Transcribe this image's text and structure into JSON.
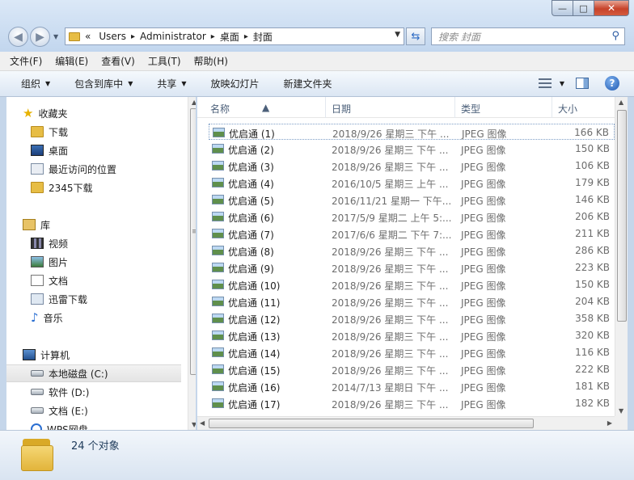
{
  "address": {
    "chevron": "«",
    "crumbs": [
      "Users",
      "Administrator",
      "桌面",
      "封面"
    ],
    "separator": "▸"
  },
  "search": {
    "placeholder": "搜索 封面"
  },
  "window_controls": {
    "minimize": "—",
    "maximize": "□",
    "close": "✕"
  },
  "menu": [
    "文件(F)",
    "编辑(E)",
    "查看(V)",
    "工具(T)",
    "帮助(H)"
  ],
  "toolbar": {
    "organize": "组织",
    "include_library": "包含到库中",
    "share": "共享",
    "slideshow": "放映幻灯片",
    "new_folder": "新建文件夹"
  },
  "nav": {
    "favorites": {
      "label": "收藏夹",
      "icon": "star-icon",
      "items": [
        {
          "label": "下载",
          "icon": "downloads-folder-icon"
        },
        {
          "label": "桌面",
          "icon": "desktop-icon"
        },
        {
          "label": "最近访问的位置",
          "icon": "recent-places-icon"
        },
        {
          "label": "2345下载",
          "icon": "folder-icon"
        }
      ]
    },
    "libraries": {
      "label": "库",
      "icon": "library-icon",
      "items": [
        {
          "label": "视频",
          "icon": "video-library-icon"
        },
        {
          "label": "图片",
          "icon": "pictures-library-icon"
        },
        {
          "label": "文档",
          "icon": "documents-library-icon"
        },
        {
          "label": "迅雷下载",
          "icon": "thunder-download-icon"
        },
        {
          "label": "音乐",
          "icon": "music-library-icon"
        }
      ]
    },
    "computer": {
      "label": "计算机",
      "icon": "computer-icon",
      "items": [
        {
          "label": "本地磁盘 (C:)",
          "icon": "system-drive-icon",
          "selected": true
        },
        {
          "label": "软件 (D:)",
          "icon": "drive-icon"
        },
        {
          "label": "文档 (E:)",
          "icon": "drive-icon"
        },
        {
          "label": "WPS网盘",
          "icon": "wps-cloud-icon"
        }
      ]
    }
  },
  "columns": {
    "name": "名称",
    "date": "日期",
    "type": "类型",
    "size": "大小"
  },
  "files": [
    {
      "name": "优启通 (1)",
      "date": "2018/9/26 星期三 下午 ...",
      "type": "JPEG 图像",
      "size": "166 KB"
    },
    {
      "name": "优启通 (2)",
      "date": "2018/9/26 星期三 下午 ...",
      "type": "JPEG 图像",
      "size": "150 KB"
    },
    {
      "name": "优启通 (3)",
      "date": "2018/9/26 星期三 下午 ...",
      "type": "JPEG 图像",
      "size": "106 KB"
    },
    {
      "name": "优启通 (4)",
      "date": "2016/10/5 星期三 上午 ...",
      "type": "JPEG 图像",
      "size": "179 KB"
    },
    {
      "name": "优启通 (5)",
      "date": "2016/11/21 星期一 下午...",
      "type": "JPEG 图像",
      "size": "146 KB"
    },
    {
      "name": "优启通 (6)",
      "date": "2017/5/9 星期二 上午 5:...",
      "type": "JPEG 图像",
      "size": "206 KB"
    },
    {
      "name": "优启通 (7)",
      "date": "2017/6/6 星期二 下午 7:...",
      "type": "JPEG 图像",
      "size": "211 KB"
    },
    {
      "name": "优启通 (8)",
      "date": "2018/9/26 星期三 下午 ...",
      "type": "JPEG 图像",
      "size": "286 KB"
    },
    {
      "name": "优启通 (9)",
      "date": "2018/9/26 星期三 下午 ...",
      "type": "JPEG 图像",
      "size": "223 KB"
    },
    {
      "name": "优启通 (10)",
      "date": "2018/9/26 星期三 下午 ...",
      "type": "JPEG 图像",
      "size": "150 KB"
    },
    {
      "name": "优启通 (11)",
      "date": "2018/9/26 星期三 下午 ...",
      "type": "JPEG 图像",
      "size": "204 KB"
    },
    {
      "name": "优启通 (12)",
      "date": "2018/9/26 星期三 下午 ...",
      "type": "JPEG 图像",
      "size": "358 KB"
    },
    {
      "name": "优启通 (13)",
      "date": "2018/9/26 星期三 下午 ...",
      "type": "JPEG 图像",
      "size": "320 KB"
    },
    {
      "name": "优启通 (14)",
      "date": "2018/9/26 星期三 下午 ...",
      "type": "JPEG 图像",
      "size": "116 KB"
    },
    {
      "name": "优启通 (15)",
      "date": "2018/9/26 星期三 下午 ...",
      "type": "JPEG 图像",
      "size": "222 KB"
    },
    {
      "name": "优启通 (16)",
      "date": "2014/7/13 星期日 下午 ...",
      "type": "JPEG 图像",
      "size": "181 KB"
    },
    {
      "name": "优启通 (17)",
      "date": "2018/9/26 星期三 下午 ...",
      "type": "JPEG 图像",
      "size": "182 KB"
    }
  ],
  "status": {
    "count": "24 个对象"
  }
}
